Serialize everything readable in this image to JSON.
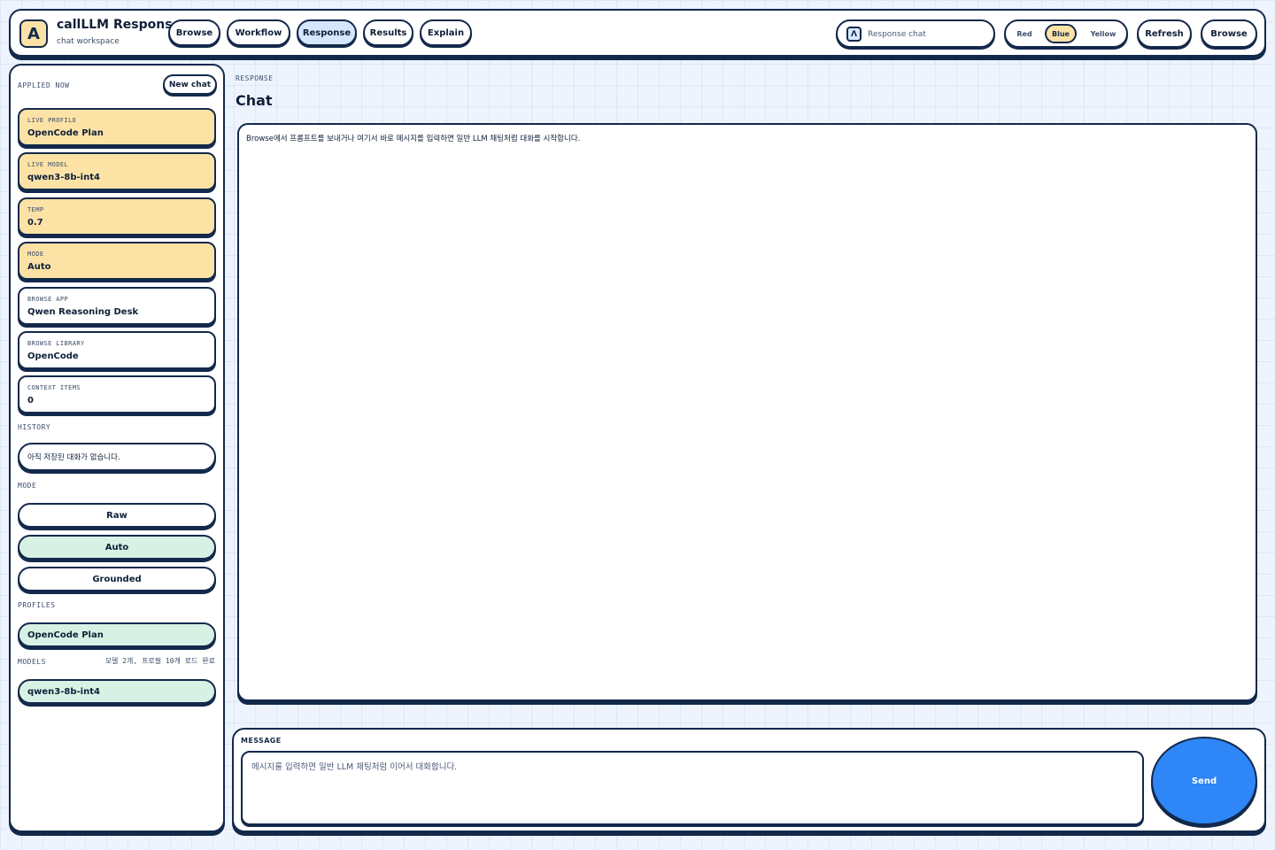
{
  "header": {
    "logo_glyph": "A",
    "title": "callLLM Response",
    "subtitle": "chat workspace",
    "nav": [
      {
        "label": "Browse",
        "active": false
      },
      {
        "label": "Workflow",
        "active": false
      },
      {
        "label": "Response",
        "active": true
      },
      {
        "label": "Results",
        "active": false
      },
      {
        "label": "Explain",
        "active": false
      }
    ],
    "search": {
      "icon": "lambda-icon",
      "icon_glyph": "Λ",
      "placeholder": "Response chat"
    },
    "theme": {
      "options": [
        "Red",
        "Blue",
        "Yellow"
      ],
      "selected": "Blue"
    },
    "refresh_label": "Refresh",
    "browse_label": "Browse"
  },
  "sidebar": {
    "applied_label": "APPLIED NOW",
    "new_chat_label": "New chat",
    "cards": [
      {
        "key": "LIVE PROFILE",
        "value": "OpenCode Plan",
        "live": true
      },
      {
        "key": "LIVE MODEL",
        "value": "qwen3-8b-int4",
        "live": true
      },
      {
        "key": "TEMP",
        "value": "0.7",
        "live": true
      },
      {
        "key": "MODE",
        "value": "Auto",
        "live": true
      },
      {
        "key": "BROWSE APP",
        "value": "Qwen Reasoning Desk",
        "live": false
      },
      {
        "key": "BROWSE LIBRARY",
        "value": "OpenCode",
        "live": false
      },
      {
        "key": "CONTEXT ITEMS",
        "value": "0",
        "live": false
      }
    ],
    "history_label": "HISTORY",
    "history_empty": "아직 저장된 대화가 없습니다.",
    "mode_label": "MODE",
    "modes": [
      {
        "label": "Raw",
        "active": false
      },
      {
        "label": "Auto",
        "active": true
      },
      {
        "label": "Grounded",
        "active": false
      }
    ],
    "profiles_label": "PROFILES",
    "profiles": [
      "OpenCode Plan"
    ],
    "models_label": "MODELS",
    "models_status": "모델 2개, 프로필 10개 로드 완료",
    "models": [
      "qwen3-8b-int4"
    ]
  },
  "main": {
    "eyebrow": "RESPONSE",
    "title": "Chat",
    "empty_message": "Browse에서 프롬프트를 보내거나 여기서 바로 메시지를 입력하면 일반 LLM 채팅처럼 대화를 시작합니다.",
    "composer": {
      "label": "MESSAGE",
      "placeholder": "메시지를 입력하면 일반 LLM 채팅처럼 이어서 대화합니다.",
      "value": "",
      "send_label": "Send"
    }
  },
  "colors": {
    "ink": "#13294b",
    "live_card": "#fde2a6",
    "active_tab": "#d6e6ff",
    "active_mode": "#d8f1e5",
    "send": "#2e86f7",
    "background": "#eef4fd"
  }
}
